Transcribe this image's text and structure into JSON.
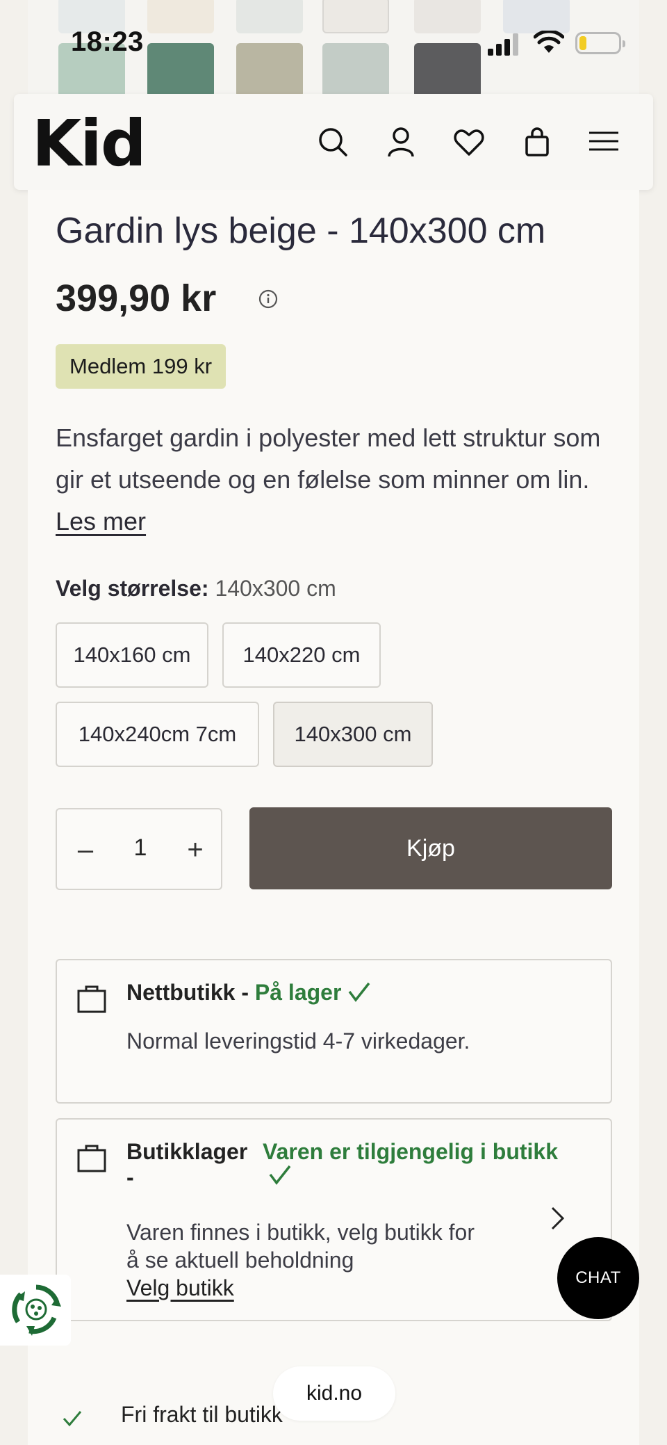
{
  "status_bar": {
    "time": "18:23"
  },
  "header": {
    "logo": "Kid"
  },
  "product": {
    "title": "Gardin lys beige - 140x300 cm",
    "price": "399,90 kr",
    "member_badge": "Medlem 199 kr",
    "description": "Ensfarget gardin i polyester med lett struktur som gir et utseende og en følelse som minner om lin.",
    "read_more": "Les mer"
  },
  "size": {
    "label": "Velg størrelse:",
    "current": "140x300 cm",
    "options": [
      "140x160 cm",
      "140x220 cm",
      "140x240cm 7cm",
      "140x300 cm"
    ],
    "selected_index": 3
  },
  "quantity": {
    "value": "1",
    "minus": "–",
    "plus": "+"
  },
  "buy_button": "Kjøp",
  "online_stock": {
    "label": "Nettbutikk -",
    "status": "På lager",
    "delivery": "Normal leveringstid 4-7 virkedager."
  },
  "store_stock": {
    "label": "Butikklager",
    "dash": "-",
    "status": "Varen er tilgjengelig i butikk",
    "line1": "Varen finnes i butikk, velg butikk for",
    "line2": "å se aktuell beholdning",
    "choose_store": "Velg butikk"
  },
  "chat_button": "CHAT",
  "browser_domain": "kid.no",
  "free_shipping": "Fri frakt til butikk",
  "colors": {
    "accent_green": "#2e7d3c",
    "buy_bg": "#5d5550",
    "member_bg": "#dfe2b3"
  },
  "icons": [
    "search-icon",
    "user-icon",
    "heart-icon",
    "bag-icon",
    "menu-icon",
    "info-icon",
    "check-icon",
    "chevron-right-icon",
    "recycle-icon"
  ]
}
